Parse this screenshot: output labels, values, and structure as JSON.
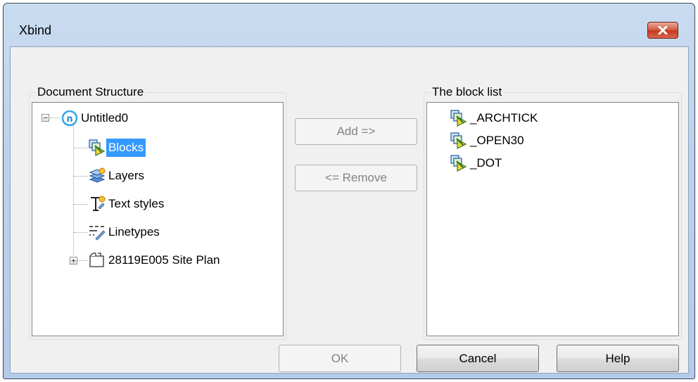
{
  "window": {
    "title": "Xbind"
  },
  "document_structure": {
    "label": "Document Structure",
    "root": {
      "label": "Untitled0",
      "icon": "drawing-n-icon",
      "expander": "−"
    },
    "children": [
      {
        "label": "Blocks",
        "icon": "blocks-icon",
        "selected": true
      },
      {
        "label": "Layers",
        "icon": "layers-icon"
      },
      {
        "label": "Text styles",
        "icon": "text-styles-icon"
      },
      {
        "label": "Linetypes",
        "icon": "linetypes-icon"
      }
    ],
    "xref": {
      "label": "28119E005 Site Plan",
      "icon": "xref-folder-icon",
      "expander": "+"
    }
  },
  "actions": {
    "add_label": "Add =>",
    "remove_label": "<= Remove"
  },
  "block_list": {
    "label": "The block list",
    "items": [
      {
        "label": "_ARCHTICK",
        "icon": "block-icon"
      },
      {
        "label": "_OPEN30",
        "icon": "block-icon"
      },
      {
        "label": "_DOT",
        "icon": "block-icon"
      }
    ]
  },
  "footer": {
    "ok_label": "OK",
    "cancel_label": "Cancel",
    "help_label": "Help"
  },
  "colors": {
    "selection": "#3399ff",
    "close_button": "#c4391f",
    "titlebar": "#bcd2ec"
  }
}
